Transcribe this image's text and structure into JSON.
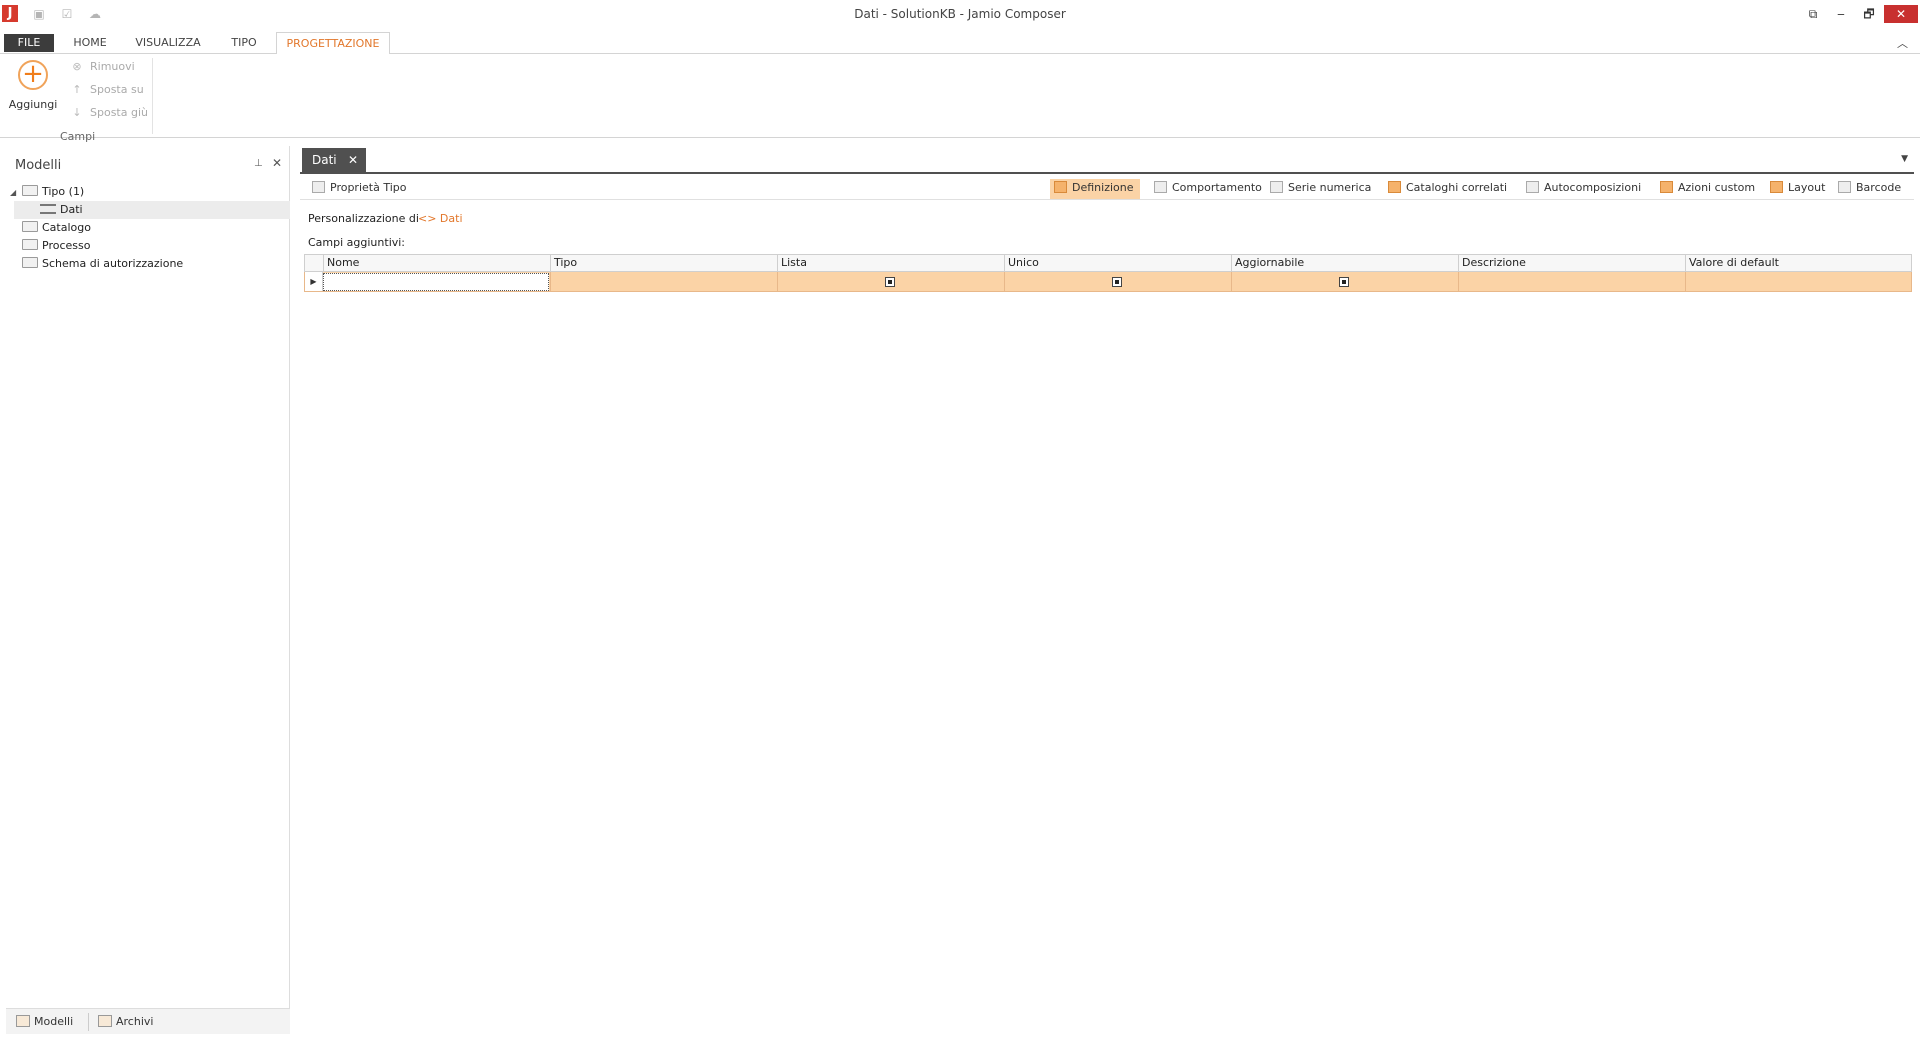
{
  "window": {
    "title": "Dati - SolutionKB - Jamio Composer",
    "logo_letter": "J",
    "quick_access": [
      "save-icon",
      "checklist-icon",
      "cloud-icon"
    ],
    "controls": {
      "restore_ribbon": "⧉",
      "minimize": "‒",
      "maximize": "🗗",
      "close": "✕"
    }
  },
  "ribbon": {
    "tabs": [
      "FILE",
      "HOME",
      "VISUALIZZA",
      "TIPO",
      "PROGETTAZIONE"
    ],
    "active_tab": "PROGETTAZIONE",
    "collapse_glyph": "︿",
    "add": {
      "label": "Aggiungi",
      "glyph": "+"
    },
    "small_commands": [
      {
        "label": "Rimuovi",
        "icon": "remove-icon",
        "glyph": "⊗"
      },
      {
        "label": "Sposta su",
        "icon": "arrow-up-icon",
        "glyph": "↑"
      },
      {
        "label": "Sposta giù",
        "icon": "arrow-down-icon",
        "glyph": "↓"
      }
    ],
    "group_label": "Campi"
  },
  "left_pane": {
    "title": "Modelli",
    "pin_glyph": "📌",
    "close_glyph": "✕",
    "tree": [
      {
        "label": "Tipo (1)",
        "icon": "folder-icon",
        "expanded": true
      },
      {
        "label": "Dati",
        "icon": "document-icon",
        "selected": true
      },
      {
        "label": "Catalogo",
        "icon": "folder-icon"
      },
      {
        "label": "Processo",
        "icon": "folder-icon"
      },
      {
        "label": "Schema di autorizzazione",
        "icon": "folder-icon"
      }
    ],
    "bottom_tabs": [
      "Modelli",
      "Archivi"
    ]
  },
  "document": {
    "tab_label": "Dati",
    "tab_close": "✕",
    "toolbar": {
      "left": "Proprietà Tipo",
      "right": [
        "Definizione",
        "Comportamento",
        "Serie numerica",
        "Cataloghi correlati",
        "Autocomposizioni",
        "Azioni custom",
        "Layout",
        "Barcode"
      ],
      "active": "Definizione"
    },
    "customization_label": "Personalizzazione di",
    "customization_link": "<> Dati",
    "fields_label": "Campi aggiuntivi:",
    "grid": {
      "columns": [
        "Nome",
        "Tipo",
        "Lista",
        "Unico",
        "Aggiornabile",
        "Descrizione",
        "Valore di default"
      ],
      "row": {
        "Nome": "",
        "Tipo": "",
        "Lista": true,
        "Unico": true,
        "Aggiornabile": true,
        "Descrizione": "",
        "Valore di default": ""
      }
    }
  },
  "colors": {
    "accent": "#e2772b",
    "selection": "#fbd3a6",
    "tab_dark": "#505050",
    "close_red": "#c8302f"
  }
}
